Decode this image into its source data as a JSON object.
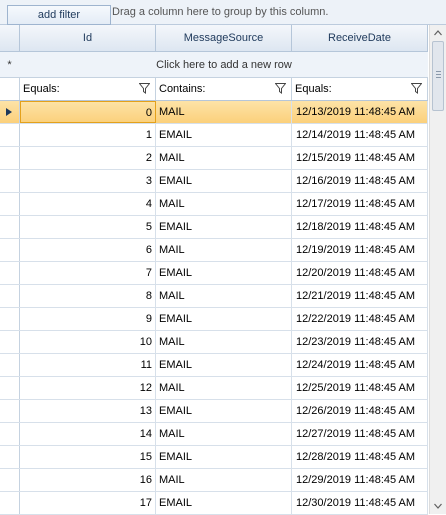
{
  "toolbar": {
    "add_filter_label": "add filter"
  },
  "group_panel": {
    "text": "Drag a column here to group by this column."
  },
  "columns": [
    "Id",
    "MessageSource",
    "ReceiveDate"
  ],
  "new_row_text": "Click here to add a new row",
  "new_row_marker": "*",
  "filters": [
    "Equals:",
    "Contains:",
    "Equals:"
  ],
  "rows": [
    {
      "id": "0",
      "source": "MAIL",
      "date": "12/13/2019 11:48:45 AM"
    },
    {
      "id": "1",
      "source": "EMAIL",
      "date": "12/14/2019 11:48:45 AM"
    },
    {
      "id": "2",
      "source": "MAIL",
      "date": "12/15/2019 11:48:45 AM"
    },
    {
      "id": "3",
      "source": "EMAIL",
      "date": "12/16/2019 11:48:45 AM"
    },
    {
      "id": "4",
      "source": "MAIL",
      "date": "12/17/2019 11:48:45 AM"
    },
    {
      "id": "5",
      "source": "EMAIL",
      "date": "12/18/2019 11:48:45 AM"
    },
    {
      "id": "6",
      "source": "MAIL",
      "date": "12/19/2019 11:48:45 AM"
    },
    {
      "id": "7",
      "source": "EMAIL",
      "date": "12/20/2019 11:48:45 AM"
    },
    {
      "id": "8",
      "source": "MAIL",
      "date": "12/21/2019 11:48:45 AM"
    },
    {
      "id": "9",
      "source": "EMAIL",
      "date": "12/22/2019 11:48:45 AM"
    },
    {
      "id": "10",
      "source": "MAIL",
      "date": "12/23/2019 11:48:45 AM"
    },
    {
      "id": "11",
      "source": "EMAIL",
      "date": "12/24/2019 11:48:45 AM"
    },
    {
      "id": "12",
      "source": "MAIL",
      "date": "12/25/2019 11:48:45 AM"
    },
    {
      "id": "13",
      "source": "EMAIL",
      "date": "12/26/2019 11:48:45 AM"
    },
    {
      "id": "14",
      "source": "MAIL",
      "date": "12/27/2019 11:48:45 AM"
    },
    {
      "id": "15",
      "source": "EMAIL",
      "date": "12/28/2019 11:48:45 AM"
    },
    {
      "id": "16",
      "source": "MAIL",
      "date": "12/29/2019 11:48:45 AM"
    },
    {
      "id": "17",
      "source": "EMAIL",
      "date": "12/30/2019 11:48:45 AM"
    }
  ],
  "selected_row_index": 0,
  "colors": {
    "selection": "#fbd07b",
    "header_text": "#1e395b",
    "grid_line": "#d7e0ea"
  },
  "icons": {
    "row_indicator": "current-row-arrow-icon",
    "filter": "filter-funnel-icon"
  }
}
